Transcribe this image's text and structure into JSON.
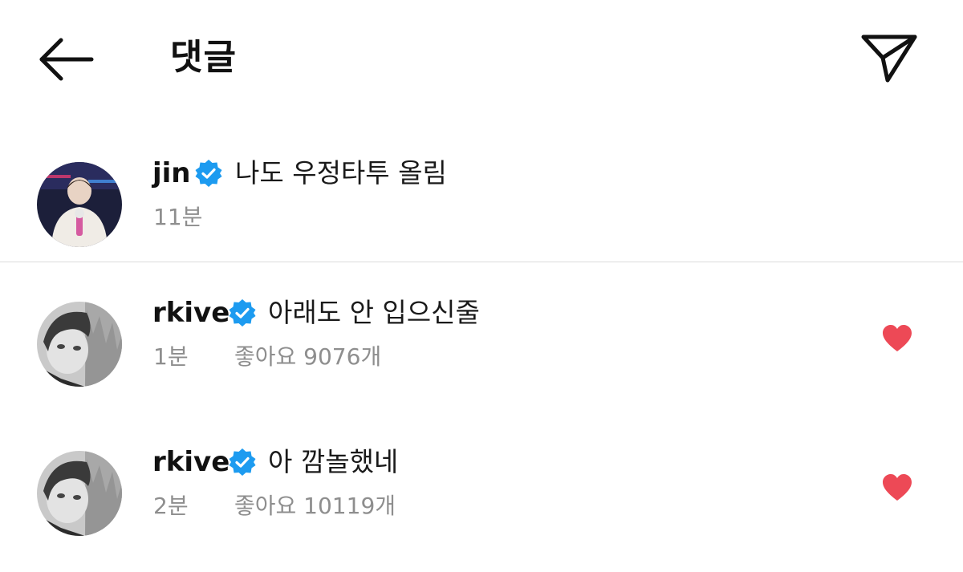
{
  "header": {
    "title": "댓글",
    "back_icon": "arrow-left-icon",
    "send_icon": "paper-plane-icon"
  },
  "comments": [
    {
      "username": "jin",
      "verified": true,
      "text": "나도 우정타투 올림",
      "time": "11분",
      "likes": "",
      "liked": false
    },
    {
      "username": "rkive",
      "verified": true,
      "text": "아래도 안 입으신줄",
      "time": "1분",
      "likes": "좋아요 9076개",
      "liked": true
    },
    {
      "username": "rkive",
      "verified": true,
      "text": "아 깜놀했네",
      "time": "2분",
      "likes": "좋아요 10119개",
      "liked": true
    }
  ],
  "colors": {
    "verified_badge": "#1d9bf0",
    "heart": "#ed4956",
    "meta_text": "#8e8e8e",
    "divider": "#dcdcdc"
  }
}
